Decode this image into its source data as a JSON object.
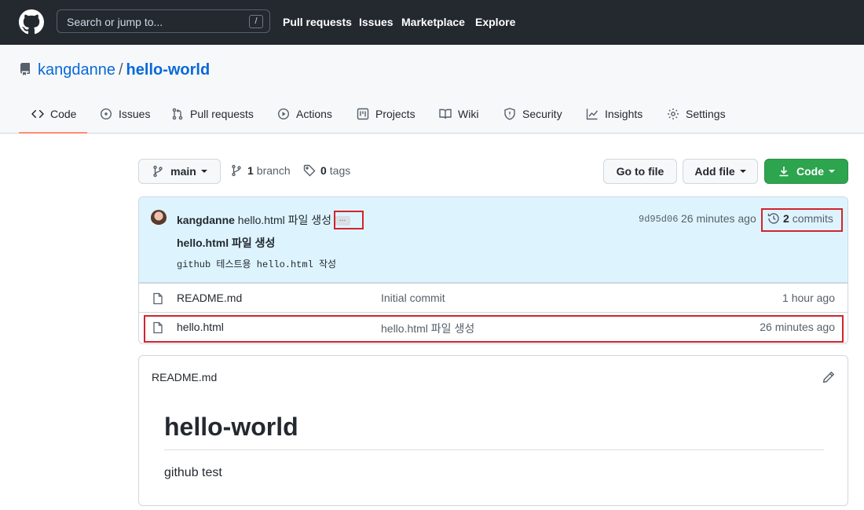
{
  "header": {
    "search_placeholder": "Search or jump to...",
    "search_shortcut": "/",
    "nav": [
      "Pull requests",
      "Issues",
      "Marketplace",
      "Explore"
    ]
  },
  "repo": {
    "owner": "kangdanne",
    "separator": "/",
    "name": "hello-world"
  },
  "tabs": [
    {
      "label": "Code",
      "icon": "code-icon",
      "active": true
    },
    {
      "label": "Issues",
      "icon": "issue-icon"
    },
    {
      "label": "Pull requests",
      "icon": "pull-request-icon"
    },
    {
      "label": "Actions",
      "icon": "play-icon"
    },
    {
      "label": "Projects",
      "icon": "project-icon"
    },
    {
      "label": "Wiki",
      "icon": "book-icon"
    },
    {
      "label": "Security",
      "icon": "shield-icon"
    },
    {
      "label": "Insights",
      "icon": "graph-icon"
    },
    {
      "label": "Settings",
      "icon": "gear-icon"
    }
  ],
  "toolbar": {
    "branch": "main",
    "branch_count": "1",
    "branch_label": "branch",
    "tag_count": "0",
    "tag_label": "tags",
    "go_to_file": "Go to file",
    "add_file": "Add file",
    "code": "Code"
  },
  "commit": {
    "author": "kangdanne",
    "message": "hello.html 파일 생성",
    "ellipsis": "...",
    "sha": "9d95d06",
    "time": "26 minutes ago",
    "count": "2",
    "count_label": "commits",
    "title": "hello.html 파일 생성",
    "description": "github 테스트용 hello.html 작성"
  },
  "files": [
    {
      "name": "README.md",
      "message": "Initial commit",
      "age": "1 hour ago"
    },
    {
      "name": "hello.html",
      "message": "hello.html 파일 생성",
      "age": "26 minutes ago"
    }
  ],
  "readme": {
    "label": "README.md",
    "heading": "hello-world",
    "body": "github test"
  },
  "colors": {
    "header_bg": "#24292f",
    "link": "#0969da",
    "active_tab": "#fd8c73",
    "green_button": "#2da44e",
    "highlight": "#d1242f",
    "commit_bg": "#ddf4ff"
  }
}
